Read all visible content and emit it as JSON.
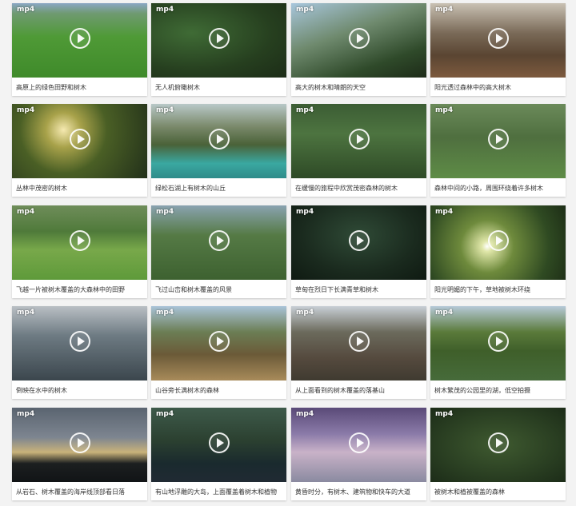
{
  "badge": "mp4",
  "videos": [
    {
      "caption": "高原上的绿色田野和树木"
    },
    {
      "caption": "无人机俯瞰树木"
    },
    {
      "caption": "高大的树木和晴朗的天空"
    },
    {
      "caption": "阳光透过森林中的高大树木"
    },
    {
      "caption": "丛林中茂密的树木"
    },
    {
      "caption": "绿松石湖上有树木的山丘"
    },
    {
      "caption": "在缓慢的旅程中欣赏茂密森林的树木"
    },
    {
      "caption": "森林中间的小路，周围环绕着许多树木"
    },
    {
      "caption": "飞越一片被树木覆盖的大森林中的田野"
    },
    {
      "caption": "飞过山峦和树木覆盖的风景"
    },
    {
      "caption": "草甸在烈日下长满青草和树木"
    },
    {
      "caption": "阳光明媚的下午，草地被树木环绕"
    },
    {
      "caption": "倒映在水中的树木"
    },
    {
      "caption": "山谷旁长满树木的森林"
    },
    {
      "caption": "从上面看到的树木覆盖的落基山"
    },
    {
      "caption": "树木繁茂的公园里的湖，低空拍摄"
    },
    {
      "caption": "从岩石、树木覆盖的海岸线顶部看日落"
    },
    {
      "caption": "有山地浮雕的大岛，上面覆盖着树木和植物"
    },
    {
      "caption": "黄昏时分，有树木、建筑物和快车的大道"
    },
    {
      "caption": "被树木和植被覆盖的森林"
    }
  ]
}
